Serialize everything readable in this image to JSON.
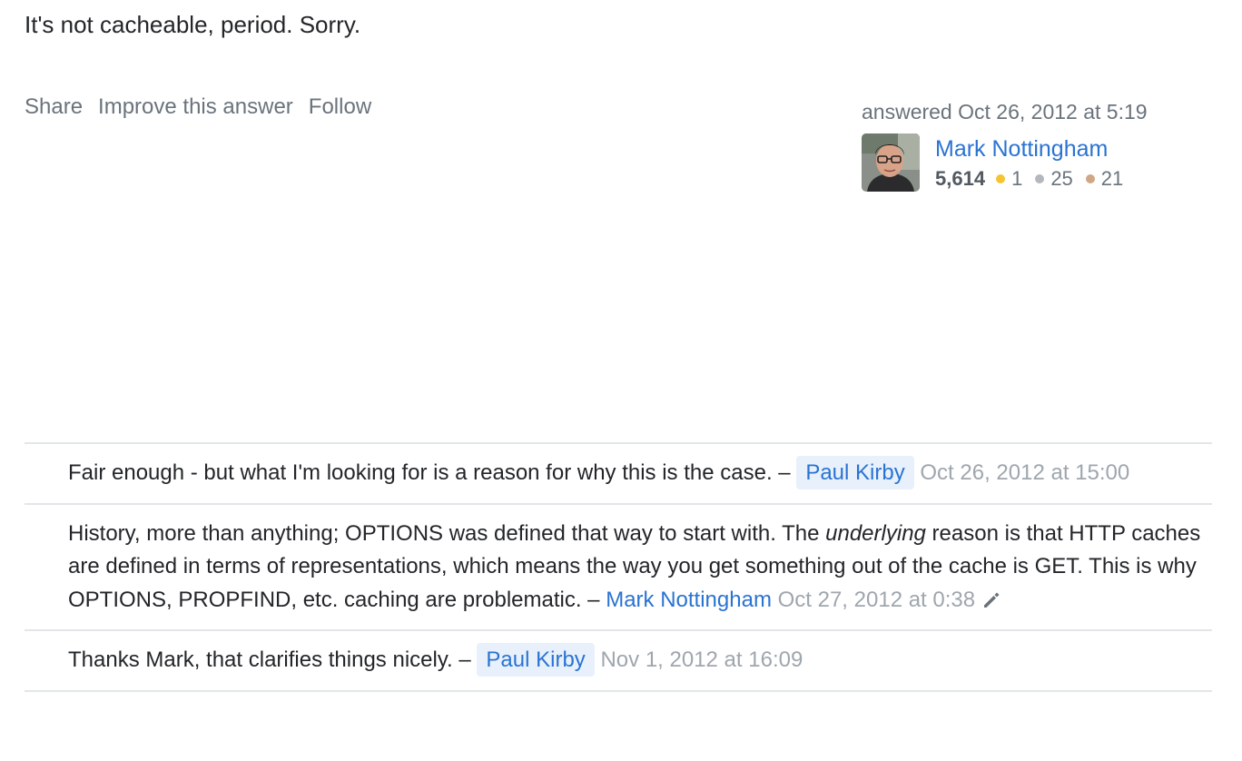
{
  "answer": {
    "body_text": "It's not cacheable, period. Sorry."
  },
  "post_menu": {
    "share": "Share",
    "improve": "Improve this answer",
    "follow": "Follow"
  },
  "user_card": {
    "action_time": "answered Oct 26, 2012 at 5:19",
    "user_name": "Mark Nottingham",
    "reputation": "5,614",
    "gold_badges": "1",
    "silver_badges": "25",
    "bronze_badges": "21",
    "avatar_icon": "user-avatar-photo"
  },
  "colors": {
    "link": "#2a73d2",
    "muted": "#6a737c",
    "date": "#9fa6ad",
    "op_highlight": "#e8f1fb",
    "gold": "#f6c430",
    "silver": "#b4b8bc",
    "bronze": "#d1a684"
  },
  "comments": [
    {
      "text": "Fair enough - but what I'm looking for is a reason for why this is the case.",
      "separator": " – ",
      "user": "Paul Kirby",
      "date": "Oct 26, 2012 at 15:00"
    },
    {
      "text_before": "History, more than anything; OPTIONS was defined that way to start with. The ",
      "text_em": "underlying",
      "text_after": " reason is that HTTP caches are defined in terms of representations, which means the way you get something out of the cache is GET. This is why OPTIONS, PROPFIND, etc. caching are problematic.",
      "separator": " – ",
      "user": "Mark Nottingham",
      "date": "Oct 27, 2012 at 0:38",
      "edited_icon": "pencil-icon"
    },
    {
      "text": "Thanks Mark, that clarifies things nicely.",
      "separator": " – ",
      "user": "Paul Kirby",
      "date": "Nov 1, 2012 at 16:09"
    }
  ]
}
